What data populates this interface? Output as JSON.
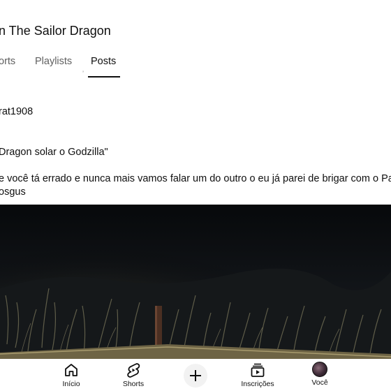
{
  "header": {
    "channel_name": "n The Sailor Dragon"
  },
  "tabs": [
    {
      "label": "orts"
    },
    {
      "label": "Playlists"
    },
    {
      "label": "Posts",
      "active": true
    }
  ],
  "post": {
    "author": "rat1908",
    "text_line1": "Dragon solar o Godzilla\"",
    "text_line2": "e você tá errado e nunca mais vamos falar um do outro o eu já parei de brigar com o Pa",
    "text_line3": "osgus",
    "image_icon": "night-field-photo"
  },
  "bottom_nav": {
    "home": {
      "label": "Início",
      "icon": "home-icon"
    },
    "shorts": {
      "label": "Shorts",
      "icon": "shorts-icon"
    },
    "create": {
      "icon": "plus-icon"
    },
    "subscriptions": {
      "label": "Inscrições",
      "icon": "subscriptions-icon"
    },
    "you": {
      "label": "Você",
      "icon": "avatar"
    }
  },
  "colors": {
    "text_primary": "#0f0f0f",
    "text_secondary": "#606060",
    "create_button_bg": "#f2f2f2",
    "image_bg": "#0d0f12"
  }
}
